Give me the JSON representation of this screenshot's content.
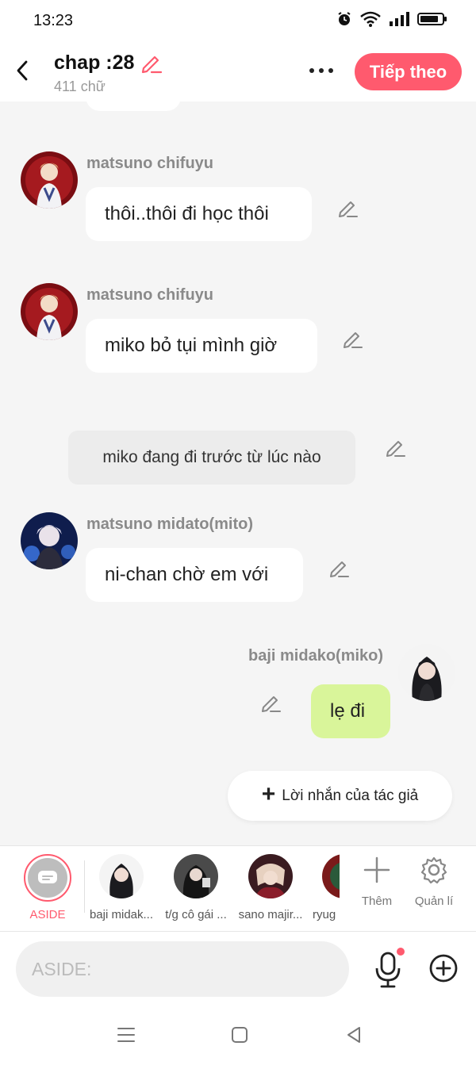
{
  "status_bar": {
    "time": "13:23"
  },
  "header": {
    "title": "chap :28",
    "subtitle": "411 chữ",
    "next_label": "Tiếp theo"
  },
  "messages": [
    {
      "sender": "matsuno chifuyu",
      "text": "thôi..thôi đi học thôi",
      "side": "left"
    },
    {
      "sender": "matsuno chifuyu",
      "text": "miko bỏ tụi mình giờ",
      "side": "left"
    },
    {
      "text": "miko đang đi trước từ lúc nào",
      "side": "narration"
    },
    {
      "sender": "matsuno midato(mito)",
      "text": "ni-chan chờ em với",
      "side": "left"
    },
    {
      "sender": "baji midako(miko)",
      "text": "lẹ đi",
      "side": "right"
    }
  ],
  "author_note_label": "Lời nhắn của tác giả",
  "character_bar": {
    "aside_label": "ASIDE",
    "characters": [
      {
        "name": "baji midak..."
      },
      {
        "name": "t/g cô gái ..."
      },
      {
        "name": "sano majir..."
      },
      {
        "name": "ryug"
      }
    ],
    "add_label": "Thêm",
    "manage_label": "Quản lí"
  },
  "input": {
    "placeholder": "ASIDE:"
  },
  "colors": {
    "accent": "#ff5a6e",
    "my_bubble": "#d9f59a",
    "background": "#f5f5f5"
  }
}
